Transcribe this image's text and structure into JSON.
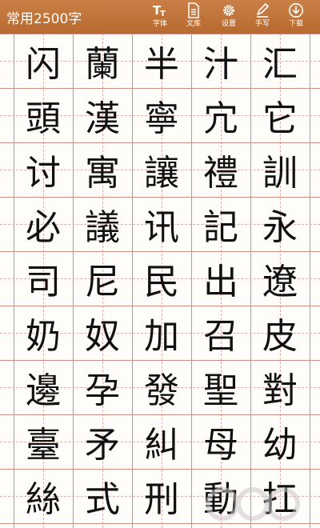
{
  "header": {
    "title": "常用2500字",
    "tools": [
      {
        "label": "字体",
        "icon": "font-icon"
      },
      {
        "label": "文库",
        "icon": "document-icon"
      },
      {
        "label": "设置",
        "icon": "gear-icon"
      },
      {
        "label": "手写",
        "icon": "pen-icon"
      },
      {
        "label": "下载",
        "icon": "download-icon"
      }
    ]
  },
  "colors": {
    "header": "#b86a30",
    "grid_line": "#cf8d83",
    "grid_dash": "#dcb0aa"
  },
  "grid": {
    "rows": [
      [
        "闪",
        "蘭",
        "半",
        "汁",
        "汇"
      ],
      [
        "頭",
        "漢",
        "寧",
        "宂",
        "它"
      ],
      [
        "讨",
        "寓",
        "讓",
        "禮",
        "訓"
      ],
      [
        "必",
        "議",
        "讯",
        "記",
        "永"
      ],
      [
        "司",
        "尼",
        "民",
        "出",
        "遼"
      ],
      [
        "奶",
        "奴",
        "加",
        "召",
        "皮"
      ],
      [
        "邊",
        "孕",
        "發",
        "聖",
        "對"
      ],
      [
        "臺",
        "矛",
        "糾",
        "母",
        "幼"
      ],
      [
        "絲",
        "式",
        "刑",
        "動",
        "扛"
      ]
    ]
  }
}
